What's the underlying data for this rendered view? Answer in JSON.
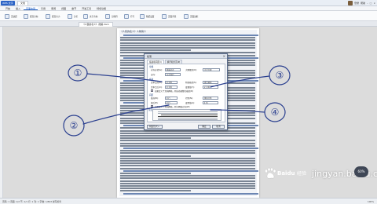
{
  "app": {
    "badge": "WPS 文字",
    "file_tab": "文档",
    "right_items": [
      "登录",
      "帮助"
    ]
  },
  "menu": [
    "开始",
    "插入",
    "页面布局",
    "引用",
    "审阅",
    "视图",
    "章节",
    "开发工具",
    "特色功能"
  ],
  "menu_active_index": 2,
  "ribbon_groups": [
    "页边距",
    "纸张方向",
    "纸张大小",
    "分栏",
    "文字方向",
    "分隔符",
    "行号",
    "稿纸设置",
    "页面背景",
    "页面边框"
  ],
  "doc_tab": "《人民的名义》-陆毅.docx",
  "doc_heading": "《人民的名义》人物简介",
  "dialog": {
    "title": "段落",
    "close": "×",
    "tabs": [
      "缩进和间距(I)",
      "换行和分页(P)"
    ],
    "sections": {
      "general": "常规",
      "indent": "缩进",
      "spacing": "间距",
      "preview": "预览"
    },
    "labels": {
      "align": "对齐方式(G):",
      "outline": "大纲级别(O):",
      "direction": "方向:",
      "left": "文本之前(R):",
      "right": "文本之后(X):",
      "special": "特殊格式(S):",
      "measure": "度量值(Y):",
      "before": "段前(B):",
      "after": "段后(E):",
      "line_spacing": "行距(N):",
      "at": "设置值(A):",
      "chk1": "如果定义了文档网格，则自动调整右缩进(D)",
      "chk2": "如果定义了文档网格，则与网格对齐(W)"
    },
    "values": {
      "align": "两端对齐",
      "outline": "正文文本",
      "direction": "从左向右",
      "left": "0 字符",
      "right": "0 字符",
      "special": "首行缩进",
      "measure": "2 字符",
      "before": "0 行",
      "after": "0 行",
      "line_spacing": "单倍行距",
      "at": "1 倍"
    },
    "buttons": {
      "tabs": "制表位(T)...",
      "ok": "确定",
      "cancel": "取消"
    }
  },
  "annotations": [
    "①",
    "②",
    "③",
    "④"
  ],
  "status": {
    "left": "页码: 1  页面: 1/2  节: 1/1  行: 1  列: 1  字数: 1/843  拼写检查",
    "zoom": "100%"
  },
  "watermark": {
    "brand": "Baidu",
    "brand_cn": "经验",
    "url": "jingyan.baidu.com"
  },
  "speed_badge": "60%"
}
